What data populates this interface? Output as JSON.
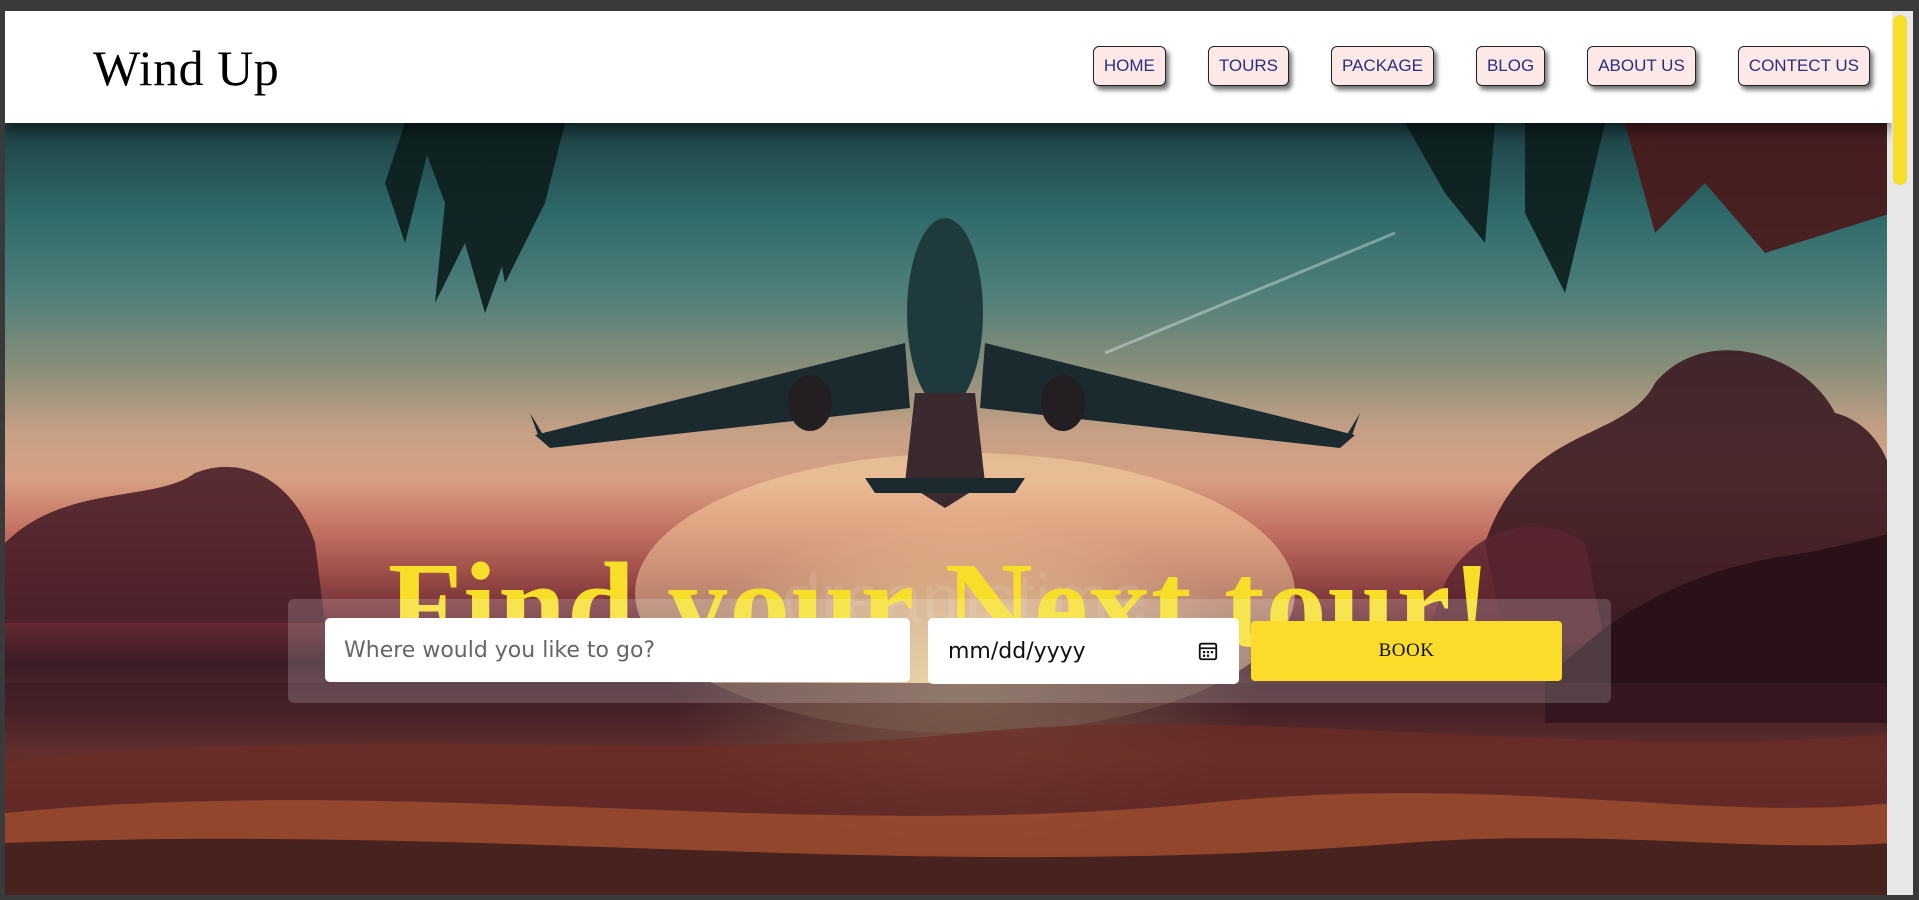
{
  "brand": {
    "name": "Wind Up"
  },
  "nav": {
    "items": [
      {
        "label": "HOME"
      },
      {
        "label": "TOURS"
      },
      {
        "label": "PACKAGE"
      },
      {
        "label": "BLOG"
      },
      {
        "label": "ABOUT US"
      },
      {
        "label": "CONTECT US"
      }
    ]
  },
  "hero": {
    "headline": "Find your Next tour!",
    "search": {
      "destination_placeholder": "Where would you like to go?",
      "destination_value": "",
      "date_value": "mm/dd/yyyy",
      "book_label": "BOOK"
    }
  },
  "colors": {
    "accent_yellow": "#f7de28",
    "book_button": "#fcdc2a",
    "nav_button_bg": "#fde8e8",
    "nav_text": "#2b2f7a"
  },
  "icons": {
    "date_picker": "calendar-icon"
  }
}
